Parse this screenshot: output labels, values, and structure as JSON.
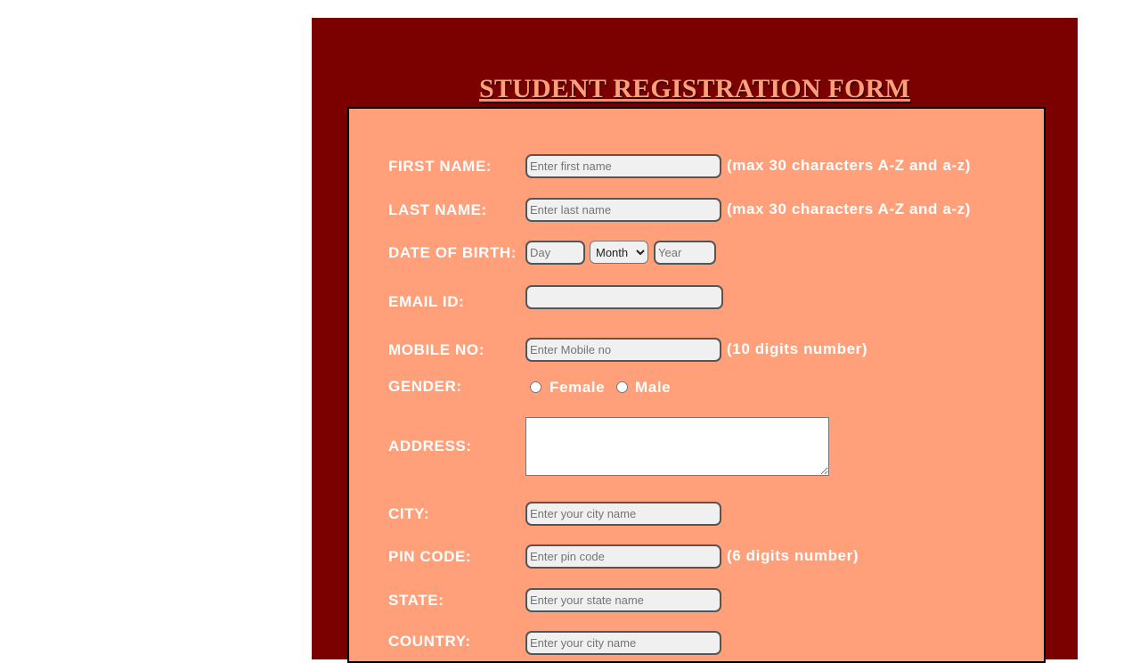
{
  "form": {
    "title": "STUDENT REGISTRATION FORM",
    "colors": {
      "outer_background": "#7b0000",
      "panel_background": "#ffa07a",
      "label_text": "#ffffff",
      "title_text": "#ffa07a"
    },
    "first_name": {
      "label": "FIRST NAME:",
      "placeholder": "Enter first name",
      "value": "",
      "hint": "(max 30 characters A-Z and a-z)"
    },
    "last_name": {
      "label": "LAST NAME:",
      "placeholder": "Enter last name",
      "value": "",
      "hint": "(max 30 characters A-Z and a-z)"
    },
    "dob": {
      "label": "DATE OF BIRTH:",
      "day_placeholder": "Day",
      "month_selected": "Month",
      "year_placeholder": "Year"
    },
    "email": {
      "label": "EMAIL ID:",
      "value": ""
    },
    "mobile": {
      "label": "MOBILE NO:",
      "placeholder": "Enter Mobile no",
      "hint": "(10 digits number)"
    },
    "gender": {
      "label": "GENDER:",
      "options": [
        "Female",
        "Male"
      ],
      "selected": null
    },
    "address": {
      "label": "ADDRESS:",
      "value": ""
    },
    "city": {
      "label": "CITY:",
      "placeholder": "Enter your city name"
    },
    "pin_code": {
      "label": "PIN CODE:",
      "placeholder": "Enter pin code",
      "hint": "(6 digits number)"
    },
    "state": {
      "label": "STATE:",
      "placeholder": "Enter your state name"
    },
    "country": {
      "label": "COUNTRY:",
      "placeholder": "Enter your city name"
    }
  }
}
